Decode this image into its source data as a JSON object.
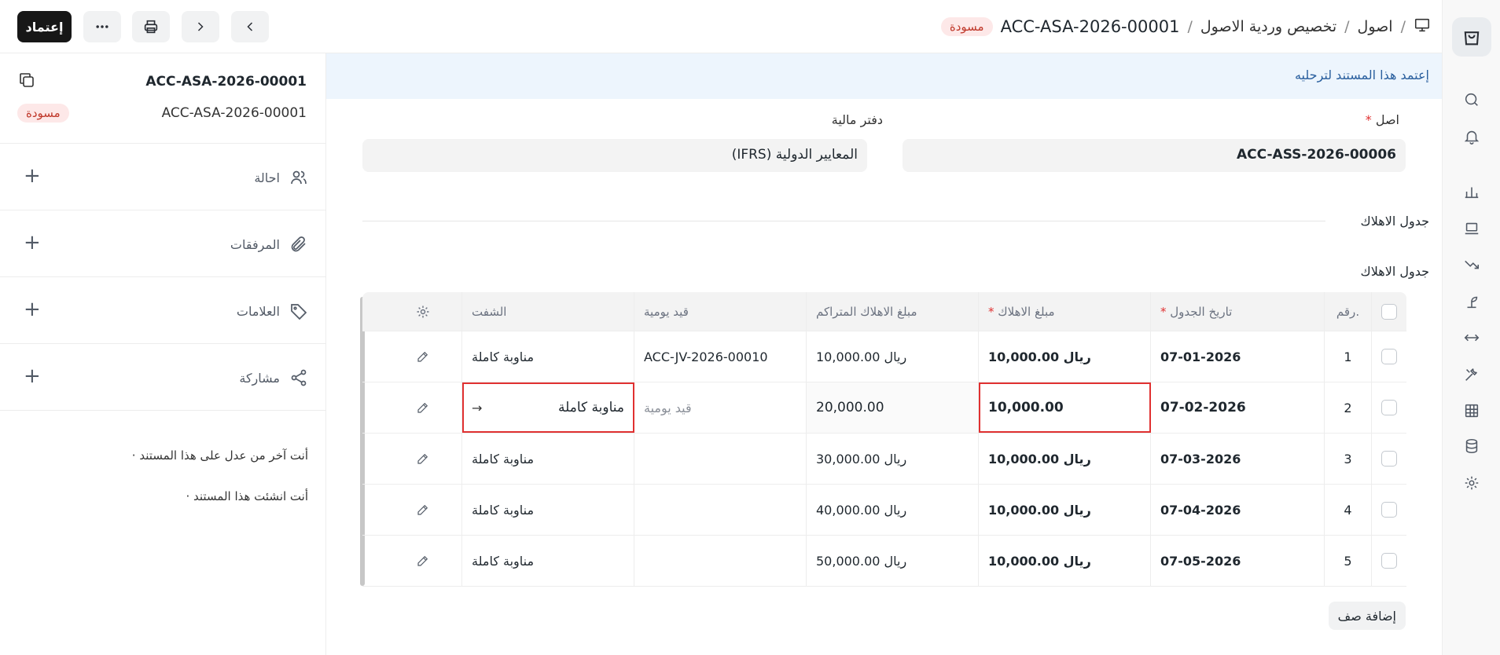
{
  "header": {
    "breadcrumb": [
      "اصول",
      "تخصيص وردية الاصول",
      "ACC-ASA-2026-00001"
    ],
    "status_badge": "مسودة",
    "submit_label": "إعتماد"
  },
  "sidebar": {
    "doc_name": "ACC-ASA-2026-00001",
    "doc_id": "ACC-ASA-2026-00001",
    "status": "مسودة",
    "items": [
      {
        "label": "احالة",
        "icon": "users-icon"
      },
      {
        "label": "المرفقات",
        "icon": "paperclip-icon"
      },
      {
        "label": "العلامات",
        "icon": "tag-icon"
      },
      {
        "label": "مشاركة",
        "icon": "share-icon"
      }
    ],
    "activity": [
      "أنت آخر من عدل على هذا المستند ·",
      "أنت انشئت هذا المستند ·"
    ]
  },
  "main": {
    "banner": "إعتمد هذا المستند لترحليه",
    "asset_label": "اصل",
    "asset_value": "ACC-ASS-2026-00006",
    "finance_book_label": "دفتر مالية",
    "finance_book_value": "المعايير الدولية (IFRS)",
    "section_title": "جدول الاهلاك",
    "table_label": "جدول الاهلاك",
    "add_row": "إضافة صف"
  },
  "table": {
    "headers": {
      "idx": "رقم.",
      "date": "تاريخ الجدول",
      "amount": "مبلغ الاهلاك",
      "accumulated": "مبلغ الاهلاك المتراكم",
      "journal": "قيد يومية",
      "shift": "الشفت"
    },
    "rows": [
      {
        "idx": "1",
        "date": "07-01-2026",
        "amount": "ريال 10,000.00",
        "accumulated": "ريال 10,000.00",
        "journal": "ACC-JV-2026-00010",
        "shift": "مناوبة كاملة"
      },
      {
        "idx": "2",
        "date": "07-02-2026",
        "amount": "10,000.00",
        "accumulated": "20,000.00",
        "journal": "قيد يومية",
        "shift": "مناوبة كاملة"
      },
      {
        "idx": "3",
        "date": "07-03-2026",
        "amount": "ريال 10,000.00",
        "accumulated": "ريال 30,000.00",
        "journal": "",
        "shift": "مناوبة كاملة"
      },
      {
        "idx": "4",
        "date": "07-04-2026",
        "amount": "ريال 10,000.00",
        "accumulated": "ريال 40,000.00",
        "journal": "",
        "shift": "مناوبة كاملة"
      },
      {
        "idx": "5",
        "date": "07-05-2026",
        "amount": "ريال 10,000.00",
        "accumulated": "ريال 50,000.00",
        "journal": "",
        "shift": "مناوبة كاملة"
      }
    ]
  }
}
